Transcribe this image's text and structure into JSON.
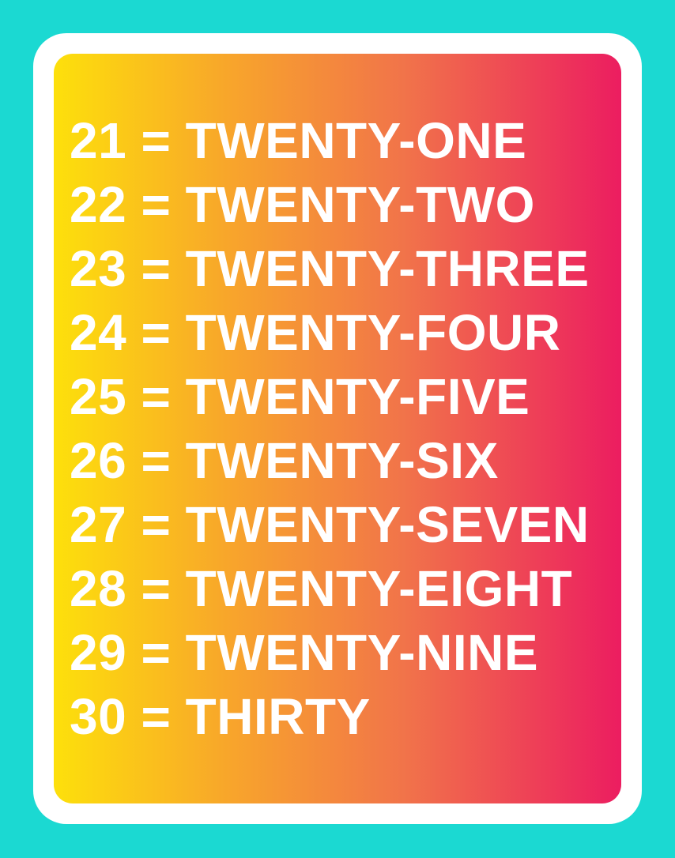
{
  "colors": {
    "background": "#1bd9d2",
    "frame": "#ffffff",
    "gradient_start": "#fde00b",
    "gradient_end": "#ec1d60",
    "text": "#ffffff"
  },
  "rows": [
    "21 = TWENTY-ONE",
    "22 = TWENTY-TWO",
    "23 = TWENTY-THREE",
    "24 = TWENTY-FOUR",
    "25 = TWENTY-FIVE",
    "26 = TWENTY-SIX",
    "27 = TWENTY-SEVEN",
    "28 = TWENTY-EIGHT",
    "29 = TWENTY-NINE",
    "30 = THIRTY"
  ]
}
